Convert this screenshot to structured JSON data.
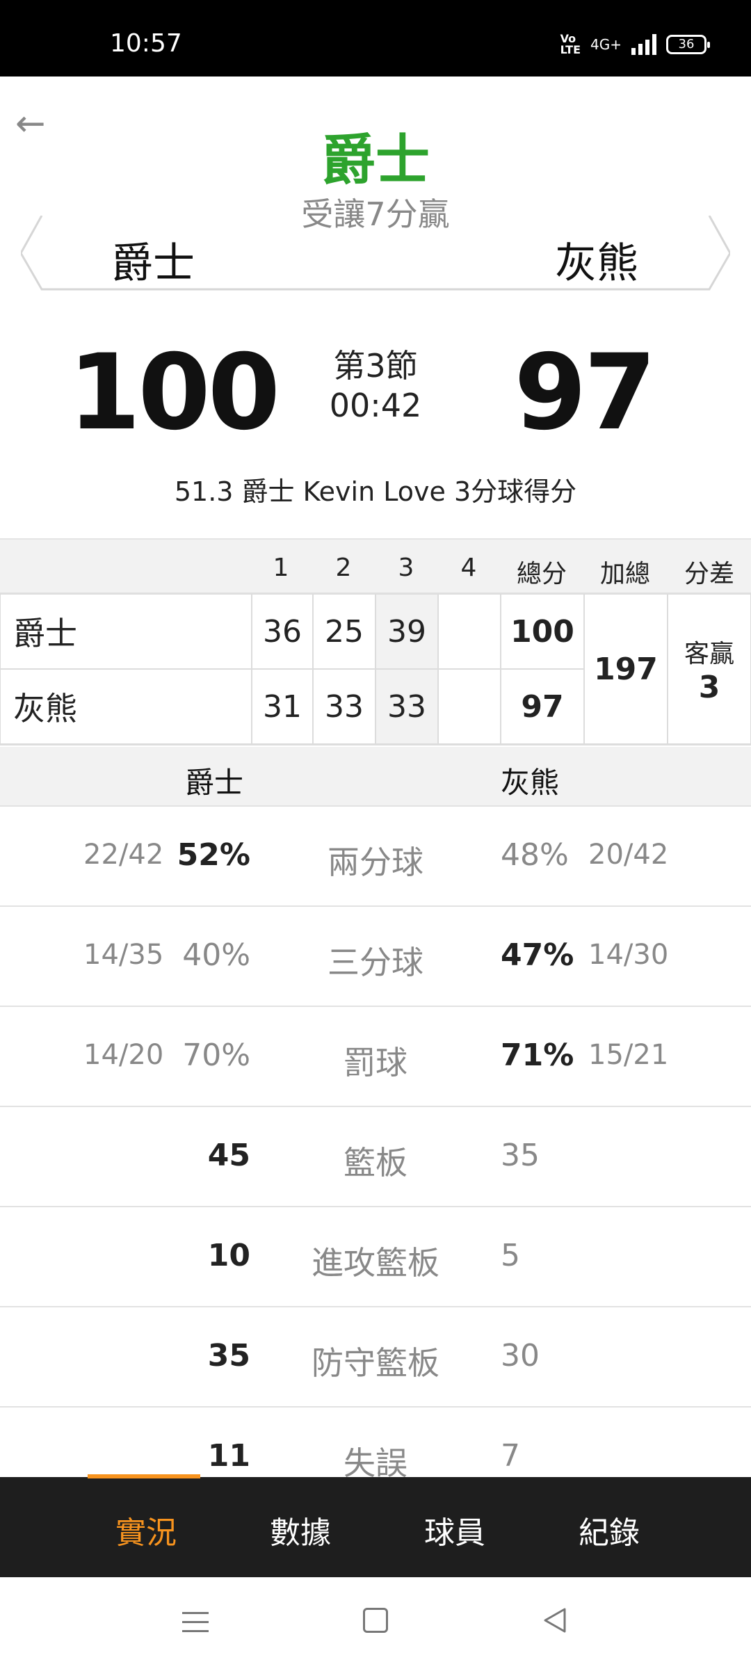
{
  "status": {
    "time": "10:57",
    "volte": "Vo\nLTE",
    "network": "4G+",
    "battery": "36"
  },
  "header": {
    "back_icon": "arrow-left-icon",
    "winner": "爵士",
    "handicap": "受讓7分贏",
    "home_team": "爵士",
    "away_team": "灰熊"
  },
  "score": {
    "home": "100",
    "away": "97",
    "period": "第3節",
    "clock": "00:42"
  },
  "last_play": "51.3 爵士 Kevin Love 3分球得分",
  "quarters": {
    "headers": [
      "1",
      "2",
      "3",
      "4",
      "總分",
      "加總",
      "分差"
    ],
    "home": {
      "name": "爵士",
      "q": [
        "36",
        "25",
        "39",
        ""
      ],
      "total": "100"
    },
    "away": {
      "name": "灰熊",
      "q": [
        "31",
        "33",
        "33",
        ""
      ],
      "total": "97"
    },
    "sum": "197",
    "diff_label": "客贏",
    "diff_value": "3"
  },
  "stats": {
    "home_team": "爵士",
    "away_team": "灰熊",
    "rows": [
      {
        "label": "兩分球",
        "home_frac": "22/42",
        "home_pct": "52%",
        "away_pct": "48%",
        "away_frac": "20/42"
      },
      {
        "label": "三分球",
        "home_frac": "14/35",
        "home_pct": "40%",
        "away_pct": "47%",
        "away_frac": "14/30"
      },
      {
        "label": "罰球",
        "home_frac": "14/20",
        "home_pct": "70%",
        "away_pct": "71%",
        "away_frac": "15/21"
      },
      {
        "label": "籃板",
        "home_val": "45",
        "away_val": "35"
      },
      {
        "label": "進攻籃板",
        "home_val": "10",
        "away_val": "5"
      },
      {
        "label": "防守籃板",
        "home_val": "35",
        "away_val": "30"
      },
      {
        "label": "失誤",
        "home_val": "11",
        "away_val": "7"
      }
    ]
  },
  "tabs": [
    "實況",
    "數據",
    "球員",
    "紀錄"
  ],
  "colors": {
    "accent": "#f7931e",
    "winner": "#2da32d",
    "tabbar": "#1e1e1e"
  }
}
